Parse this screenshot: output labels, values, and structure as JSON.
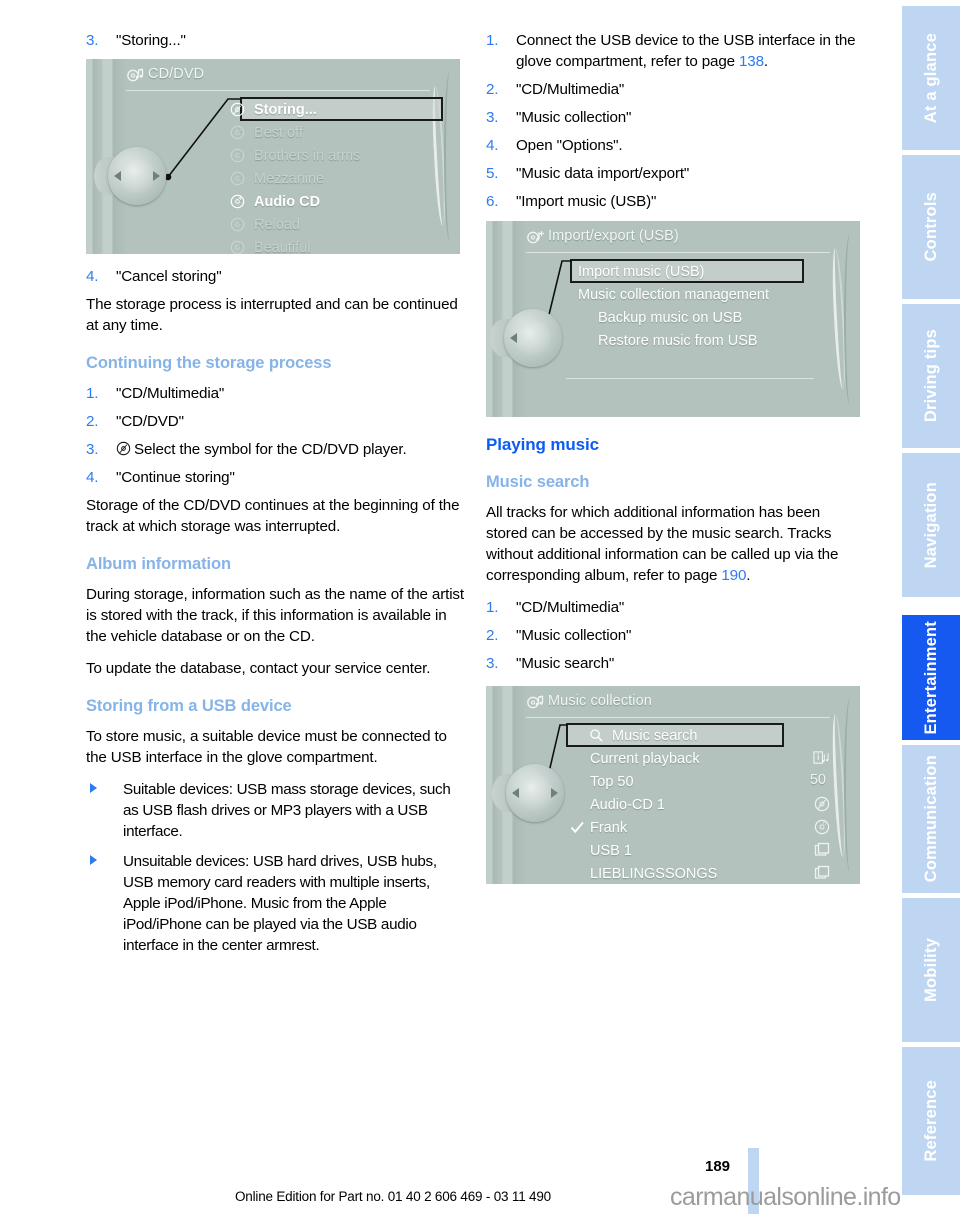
{
  "page": {
    "number": "189",
    "footer_note": "Online Edition for Part no. 01 40 2 606 469 - 03 11 490",
    "watermark": "carmanualsonline.info"
  },
  "sidebar": {
    "tabs": [
      {
        "label": "At a glance",
        "active": false
      },
      {
        "label": "Controls",
        "active": false
      },
      {
        "label": "Driving tips",
        "active": false
      },
      {
        "label": "Navigation",
        "active": false
      },
      {
        "label": "Entertainment",
        "active": true
      },
      {
        "label": "Communication",
        "active": false
      },
      {
        "label": "Mobility",
        "active": false
      },
      {
        "label": "Reference",
        "active": false
      }
    ],
    "colors": {
      "inactive": "#bed6f2",
      "active": "#1659f0",
      "text": "#ffffff"
    }
  },
  "colors": {
    "heading_major": "#0a5cf5",
    "heading_minor": "#86b3e8",
    "list_number": "#2d7bf0",
    "page_ref": "#2d7bf0",
    "screen_bg": "#b3c2bd"
  },
  "left_column": {
    "step3_label": "3.",
    "step3_text": "\"Storing...\"",
    "screen1": {
      "title": "CD/DVD",
      "title_icon": "music-note-cd-icon",
      "items": [
        {
          "label": "Storing...",
          "icon": "cd-icon",
          "state": "highlighted"
        },
        {
          "label": "Best off",
          "icon": "cd1-icon",
          "state": "dim"
        },
        {
          "label": "Brothers in arms",
          "icon": "cd2-icon",
          "state": "dim"
        },
        {
          "label": "Mezzanine",
          "icon": "cd3-icon",
          "state": "dim"
        },
        {
          "label": "Audio CD",
          "icon": "cd4-icon",
          "state": "bright"
        },
        {
          "label": "Reload",
          "icon": "cd5-icon",
          "state": "dim"
        },
        {
          "label": "Beautiful",
          "icon": "cd6-icon",
          "state": "dim"
        }
      ]
    },
    "step4_label": "4.",
    "step4_text": "\"Cancel storing\"",
    "para1": "The storage process is interrupted and can be continued at any time.",
    "heading_continuing": "Continuing the storage process",
    "continuing_steps": [
      {
        "num": "1.",
        "text": "\"CD/Multimedia\""
      },
      {
        "num": "2.",
        "text": "\"CD/DVD\""
      },
      {
        "num": "3.",
        "text": "Select the symbol for the CD/DVD player.",
        "has_icon": true
      },
      {
        "num": "4.",
        "text": "\"Continue storing\""
      }
    ],
    "para2": "Storage of the CD/DVD continues at the beginning of the track at which storage was interrupted.",
    "heading_album": "Album information",
    "para3": "During storage, information such as the name of the artist is stored with the track, if this information is available in the vehicle database or on the CD.",
    "para4": "To update the database, contact your service center.",
    "heading_usb": "Storing from a USB device",
    "para5": "To store music, a suitable device must be connected to the USB interface in the glove compartment.",
    "bullets": [
      "Suitable devices: USB mass storage devices, such as USB flash drives or MP3 players with a USB interface.",
      "Unsuitable devices: USB hard drives, USB hubs, USB memory card readers with multiple inserts, Apple iPod/iPhone. Music from the Apple iPod/iPhone can be played via the USB audio interface in the center armrest."
    ]
  },
  "right_column": {
    "usb_steps": [
      {
        "num": "1.",
        "text_before": "Connect the USB device to the USB interface in the glove compartment, refer to page ",
        "page_ref": "138",
        "text_after": "."
      },
      {
        "num": "2.",
        "text_before": "\"CD/Multimedia\""
      },
      {
        "num": "3.",
        "text_before": "\"Music collection\""
      },
      {
        "num": "4.",
        "text_before": "Open \"Options\"."
      },
      {
        "num": "5.",
        "text_before": "\"Music data import/export\""
      },
      {
        "num": "6.",
        "text_before": "\"Import music (USB)\""
      }
    ],
    "screen2": {
      "title": "Import/export (USB)",
      "title_icon": "music-note-usb-icon",
      "items": [
        {
          "label": "Import music (USB)",
          "state": "highlighted",
          "indent": 0
        },
        {
          "label": "Music collection management",
          "state": "normal",
          "indent": 0
        },
        {
          "label": "Backup music on USB",
          "state": "normal",
          "indent": 1
        },
        {
          "label": "Restore music from USB",
          "state": "normal",
          "indent": 1
        }
      ]
    },
    "heading_playing": "Playing music",
    "heading_search": "Music search",
    "para1_before": "All tracks for which additional information has been stored can be accessed by the music search. Tracks without additional information can be called up via the corresponding album, refer to page ",
    "para1_ref": "190",
    "para1_after": ".",
    "search_steps": [
      {
        "num": "1.",
        "text": "\"CD/Multimedia\""
      },
      {
        "num": "2.",
        "text": "\"Music collection\""
      },
      {
        "num": "3.",
        "text": "\"Music search\""
      }
    ],
    "screen3": {
      "title": "Music collection",
      "title_icon": "music-note-cd-icon",
      "items": [
        {
          "label": "Music search",
          "state": "highlighted",
          "left_icon": "magnifier-icon",
          "right_icon": ""
        },
        {
          "label": "Current playback",
          "state": "normal",
          "left_icon": "",
          "right_icon": "info-music-icon"
        },
        {
          "label": "Top 50",
          "state": "normal",
          "left_icon": "",
          "right_icon": "50"
        },
        {
          "label": "Audio-CD 1",
          "state": "normal",
          "left_icon": "",
          "right_icon": "cd-icon"
        },
        {
          "label": "Frank",
          "state": "normal",
          "left_icon": "check-icon",
          "right_icon": "cd6-icon"
        },
        {
          "label": "USB 1",
          "state": "normal",
          "left_icon": "",
          "right_icon": "folder-icon"
        },
        {
          "label": "LIEBLINGSSONGS",
          "state": "normal",
          "left_icon": "",
          "right_icon": "folder-icon"
        }
      ]
    }
  }
}
